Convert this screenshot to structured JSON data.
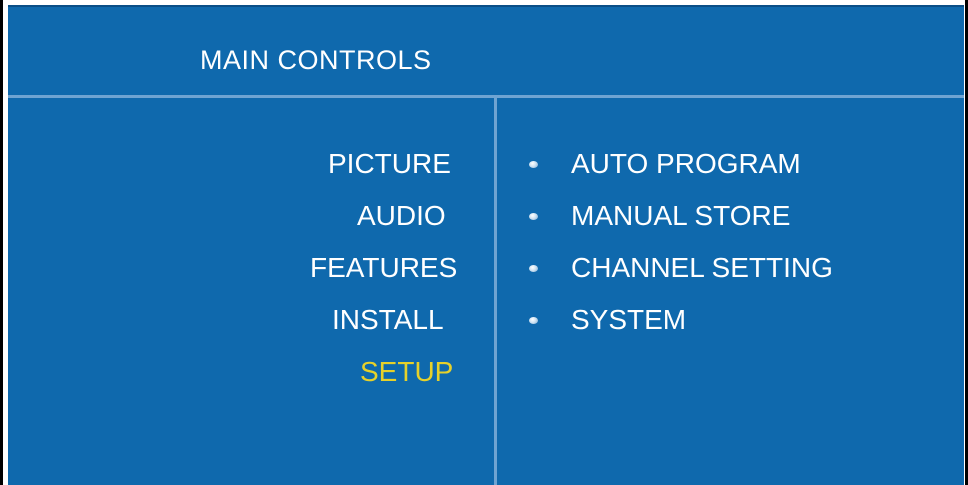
{
  "top_cropped_text": "(                                        )",
  "header": {
    "title": "MAIN  CONTROLS"
  },
  "main_menu": {
    "items": [
      {
        "label": "PICTURE",
        "selected": false
      },
      {
        "label": "AUDIO",
        "selected": false
      },
      {
        "label": "FEATURES",
        "selected": false
      },
      {
        "label": "INSTALL",
        "selected": false
      },
      {
        "label": "SETUP",
        "selected": true
      }
    ]
  },
  "sub_menu": {
    "items": [
      {
        "label": "AUTO PROGRAM"
      },
      {
        "label": "MANUAL STORE"
      },
      {
        "label": "CHANNEL SETTING"
      },
      {
        "label": "SYSTEM"
      }
    ]
  },
  "colors": {
    "panel_background": "#0f69ad",
    "divider": "#6fa4d2",
    "text": "#ffffff",
    "selected_text": "#e6d12a"
  },
  "icons": {
    "submenu_bullet": "bullet-dot-icon"
  }
}
